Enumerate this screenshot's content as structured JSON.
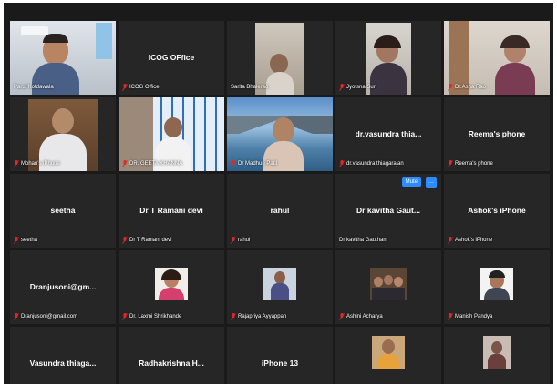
{
  "meeting": {
    "tiles": [
      {
        "name": "Parul Kotdawala",
        "center": "",
        "muted": false
      },
      {
        "name": "ICOG Office",
        "center": "ICOG OFfice",
        "muted": true
      },
      {
        "name": "Sarita Bhalerao",
        "center": "",
        "muted": false
      },
      {
        "name": "Jyotsna Suri",
        "center": "",
        "muted": true
      },
      {
        "name": "Dr.Asha Rao",
        "center": "",
        "muted": true
      },
      {
        "name": "Mohan's iPhone",
        "center": "",
        "muted": true
      },
      {
        "name": "DR. GEETA KHANNA",
        "center": "",
        "muted": true
      },
      {
        "name": "Dr Madhuri Patil",
        "center": "",
        "muted": true
      },
      {
        "name": "dr.vasundra thiagarajan",
        "center": "dr.vasundra thia...",
        "muted": true
      },
      {
        "name": "Reema's phone",
        "center": "Reema's phone",
        "muted": true
      },
      {
        "name": "seetha",
        "center": "seetha",
        "muted": true
      },
      {
        "name": "Dr T Ramani devi",
        "center": "Dr T Ramani devi",
        "muted": true
      },
      {
        "name": "rahul",
        "center": "rahul",
        "muted": true
      },
      {
        "name": "Dr kavitha Gautham",
        "center": "Dr kavitha Gaut...",
        "muted": false
      },
      {
        "name": "Ashok's iPhone",
        "center": "Ashok's iPhone",
        "muted": true
      },
      {
        "name": "Dranjusoni@gmail.com",
        "center": "Dranjusoni@gm...",
        "muted": true
      },
      {
        "name": "Dr. Laxmi Shrikhande",
        "center": "",
        "muted": true
      },
      {
        "name": "Rajapriya Ayyappan",
        "center": "",
        "muted": true
      },
      {
        "name": "Ashini Acharya",
        "center": "",
        "muted": true
      },
      {
        "name": "Manish Pandya",
        "center": "",
        "muted": true
      },
      {
        "name": "",
        "center": "Vasundra thiaga...",
        "muted": false
      },
      {
        "name": "",
        "center": "Radhakrishna H...",
        "muted": false
      },
      {
        "name": "",
        "center": "iPhone 13",
        "muted": false
      },
      {
        "name": "",
        "center": "",
        "muted": false
      },
      {
        "name": "",
        "center": "",
        "muted": false
      }
    ],
    "hover_controls": {
      "mute_label": "Mute",
      "more_label": "···"
    }
  },
  "colors": {
    "muted_mic": "#e02828",
    "speaker_border": "#b7e24f",
    "background": "#1a1a1a",
    "tile": "#262626",
    "button": "#2d8cff"
  },
  "icons": {
    "muted": "mic-muted-icon"
  }
}
